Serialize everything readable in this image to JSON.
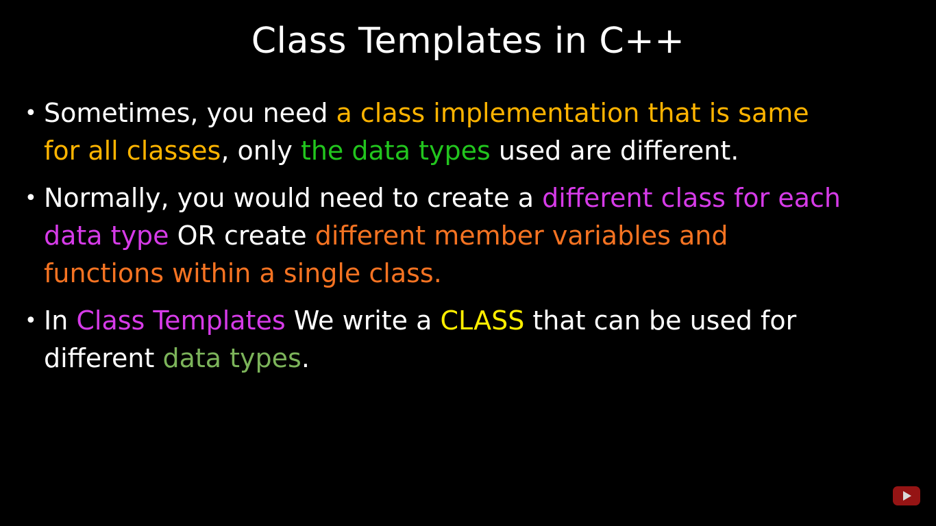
{
  "slide": {
    "title": "Class Templates in C++",
    "bullet_glyph": "•",
    "bullets": [
      {
        "lines": [
          [
            {
              "text": "Sometimes, you need ",
              "color": "#ffffff"
            },
            {
              "text": "a class implementation that is same",
              "color": "#ffb400"
            }
          ],
          [
            {
              "text": "for all classes",
              "color": "#ffb400"
            },
            {
              "text": ", only ",
              "color": "#ffffff"
            },
            {
              "text": "the data types",
              "color": "#22c51e"
            },
            {
              "text": " used are different.",
              "color": "#ffffff"
            }
          ]
        ]
      },
      {
        "lines": [
          [
            {
              "text": "Normally, you would need to create a ",
              "color": "#ffffff"
            },
            {
              "text": "different class for each",
              "color": "#d63be8"
            }
          ],
          [
            {
              "text": "data type",
              "color": "#d63be8"
            },
            {
              "text": " OR create ",
              "color": "#ffffff"
            },
            {
              "text": "different member variables and",
              "color": "#f57322"
            }
          ],
          [
            {
              "text": "functions within a single class.",
              "color": "#f57322"
            }
          ]
        ]
      },
      {
        "lines": [
          [
            {
              "text": "In ",
              "color": "#ffffff"
            },
            {
              "text": "Class Templates",
              "color": "#d63be8"
            },
            {
              "text": " We write a ",
              "color": "#ffffff"
            },
            {
              "text": "CLASS",
              "color": "#ffee00"
            },
            {
              "text": " that can be used for",
              "color": "#ffffff"
            }
          ],
          [
            {
              "text": "different ",
              "color": "#ffffff"
            },
            {
              "text": "data types",
              "color": "#7cb45a"
            },
            {
              "text": ".",
              "color": "#ffffff"
            }
          ]
        ]
      }
    ]
  },
  "player": {
    "youtube_icon": "youtube-play-icon",
    "youtube_color": "#b01818"
  }
}
